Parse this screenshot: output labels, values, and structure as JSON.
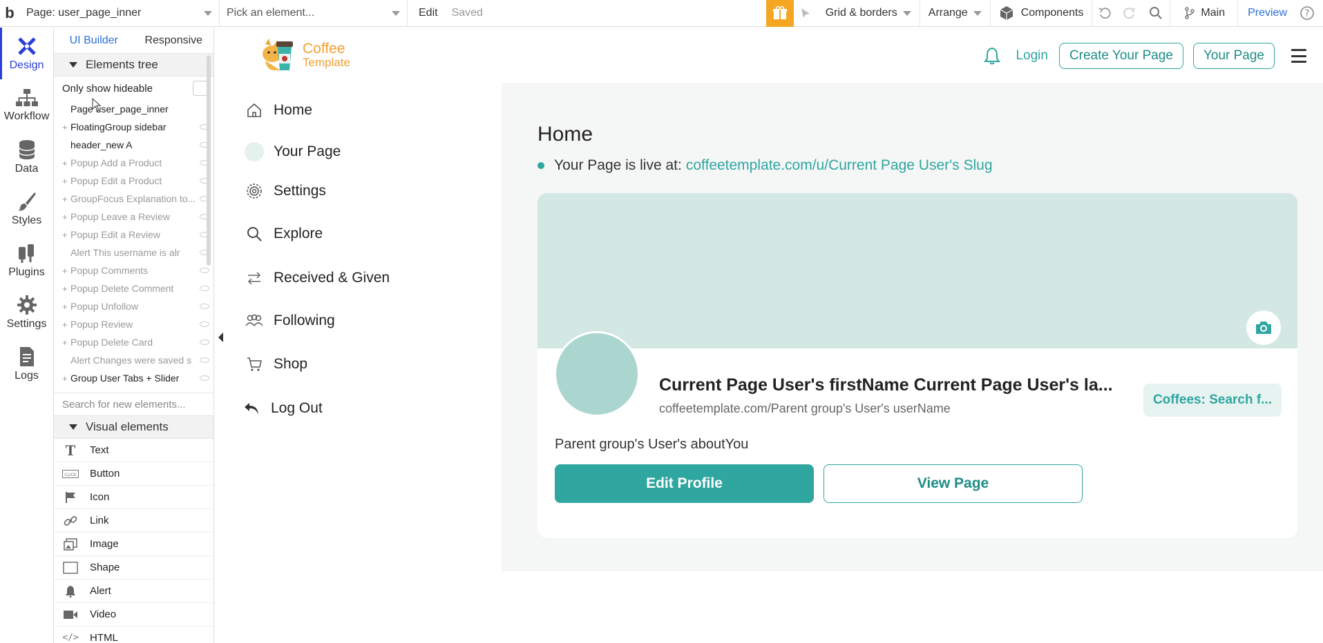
{
  "toolbar": {
    "logo": "b",
    "page_selector": "Page: user_page_inner",
    "element_picker_placeholder": "Pick an element...",
    "edit_label": "Edit",
    "saved_label": "Saved",
    "grid_label": "Grid & borders",
    "arrange_label": "Arrange",
    "components_label": "Components",
    "branch_label": "Main",
    "preview_label": "Preview"
  },
  "rail": {
    "items": [
      {
        "label": "Design",
        "icon": "design-icon"
      },
      {
        "label": "Workflow",
        "icon": "workflow-icon"
      },
      {
        "label": "Data",
        "icon": "database-icon"
      },
      {
        "label": "Styles",
        "icon": "brush-icon"
      },
      {
        "label": "Plugins",
        "icon": "plug-icon"
      },
      {
        "label": "Settings",
        "icon": "gear-icon"
      },
      {
        "label": "Logs",
        "icon": "document-icon"
      }
    ]
  },
  "panel": {
    "tabs": [
      "UI Builder",
      "Responsive"
    ],
    "tree_heading": "Elements tree",
    "only_hideable": "Only show hideable",
    "tree": [
      {
        "label": "Page user_page_inner",
        "plus": false,
        "dim": false,
        "eye": false
      },
      {
        "label": "FloatingGroup sidebar",
        "plus": true,
        "dim": false,
        "eye": true
      },
      {
        "label": "header_new A",
        "plus": false,
        "dim": false,
        "eye": true
      },
      {
        "label": "Popup Add a Product",
        "plus": true,
        "dim": true,
        "eye": true
      },
      {
        "label": "Popup Edit a Product",
        "plus": true,
        "dim": true,
        "eye": true
      },
      {
        "label": "GroupFocus Explanation to...",
        "plus": true,
        "dim": true,
        "eye": true
      },
      {
        "label": "Popup Leave a Review",
        "plus": true,
        "dim": true,
        "eye": true
      },
      {
        "label": "Popup Edit a Review",
        "plus": true,
        "dim": true,
        "eye": true
      },
      {
        "label": "Alert This username is alr",
        "plus": false,
        "dim": true,
        "eye": true
      },
      {
        "label": "Popup Comments",
        "plus": true,
        "dim": true,
        "eye": true
      },
      {
        "label": "Popup Delete Comment",
        "plus": true,
        "dim": true,
        "eye": true
      },
      {
        "label": "Popup Unfollow",
        "plus": true,
        "dim": true,
        "eye": true
      },
      {
        "label": "Popup Review",
        "plus": true,
        "dim": true,
        "eye": true
      },
      {
        "label": "Popup Delete Card",
        "plus": true,
        "dim": true,
        "eye": true
      },
      {
        "label": "Alert Changes were saved s",
        "plus": false,
        "dim": true,
        "eye": true
      },
      {
        "label": "Group User Tabs + Slider",
        "plus": true,
        "dim": false,
        "eye": true
      }
    ],
    "search_placeholder": "Search for new elements...",
    "visual_heading": "Visual elements",
    "visual_elements": [
      {
        "label": "Text",
        "icon": "text-icon"
      },
      {
        "label": "Button",
        "icon": "button-icon"
      },
      {
        "label": "Icon",
        "icon": "flag-icon"
      },
      {
        "label": "Link",
        "icon": "link-icon"
      },
      {
        "label": "Image",
        "icon": "image-icon"
      },
      {
        "label": "Shape",
        "icon": "shape-icon"
      },
      {
        "label": "Alert",
        "icon": "bell-icon"
      },
      {
        "label": "Video",
        "icon": "video-icon"
      },
      {
        "label": "HTML",
        "icon": "code-icon"
      }
    ]
  },
  "app": {
    "brand_line1": "Coffee",
    "brand_line2": "Template",
    "login": "Login",
    "create_page": "Create Your Page",
    "your_page": "Your Page",
    "nav": [
      {
        "label": "Home",
        "icon": "home-icon"
      },
      {
        "label": "Your Page",
        "icon": "avatar-icon"
      },
      {
        "label": "Settings",
        "icon": "gear-icon"
      },
      {
        "label": "Explore",
        "icon": "search-icon"
      },
      {
        "label": "Received & Given",
        "icon": "swap-icon"
      },
      {
        "label": "Following",
        "icon": "people-icon"
      },
      {
        "label": "Shop",
        "icon": "cart-icon"
      },
      {
        "label": "Log Out",
        "icon": "logout-icon"
      }
    ],
    "main": {
      "title": "Home",
      "live_prefix": "Your Page is live at:",
      "live_link": "coffeetemplate.com/u/Current Page User's Slug",
      "profile_name": "Current Page User's firstName Current Page User's la...",
      "profile_url": "coffeetemplate.com/Parent group's User's userName",
      "coffees_button": "Coffees: Search f...",
      "about": "Parent group's User's aboutYou",
      "edit_button": "Edit Profile",
      "view_button": "View Page"
    }
  },
  "colors": {
    "accent": "#2fa6a0",
    "cover": "#d3e7e3",
    "avatar": "#abd6cf",
    "brand": "#f0a030",
    "editor_blue": "#2a3fd6"
  }
}
